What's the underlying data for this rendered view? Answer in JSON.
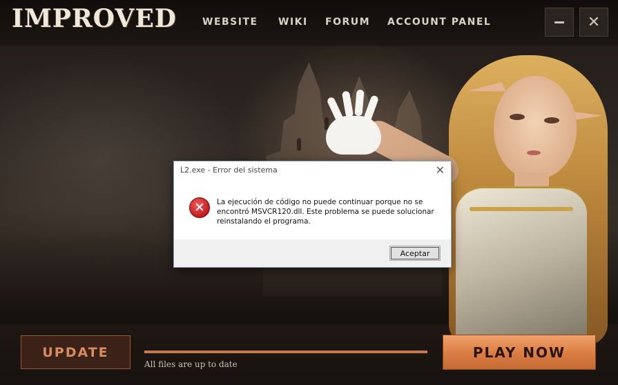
{
  "app": {
    "logo_text": "IMPROVED",
    "nav": {
      "website": "WEBSITE",
      "wiki": "WIKI",
      "forum": "FORUM",
      "account_panel": "ACCOUNT PANEL"
    },
    "window_controls": {
      "minimize_icon": "minus-icon",
      "close_icon": "close-icon",
      "close_glyph": "✕"
    }
  },
  "bottom_bar": {
    "update_label": "UPDATE",
    "play_label": "PLAY NOW",
    "status_text": "All files are up to date",
    "progress_percent": 100,
    "accent_color": "#dc7f45"
  },
  "dialog": {
    "title": "L2.exe - Error del sistema",
    "close_glyph": "✕",
    "icon": "error-icon",
    "icon_glyph": "✕",
    "message": "La ejecución de código no puede continuar porque no se encontró MSVCR120.dll. Este problema se puede solucionar reinstalando el programa.",
    "ok_label": "Aceptar"
  }
}
